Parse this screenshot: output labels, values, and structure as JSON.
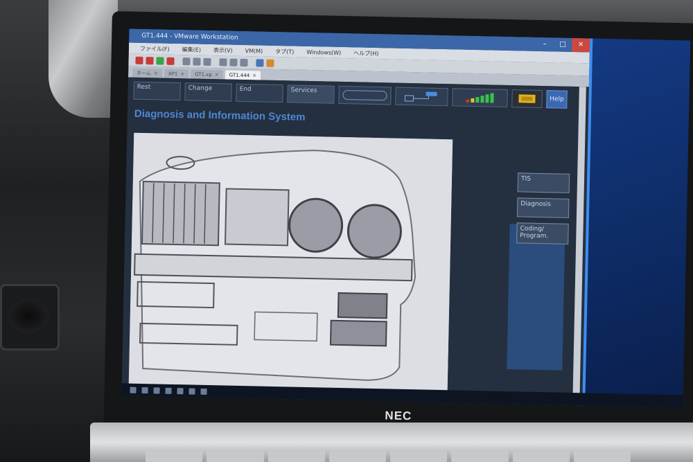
{
  "window": {
    "title": "GT1.444 - VMware Workstation"
  },
  "menu": [
    "ファイル(F)",
    "編集(E)",
    "表示(V)",
    "VM(M)",
    "タブ(T)",
    "Windows(W)",
    "ヘルプ(H)"
  ],
  "tabs": [
    {
      "label": "ホーム",
      "active": false
    },
    {
      "label": "XP1",
      "active": false
    },
    {
      "label": "GT1.xp",
      "active": false
    },
    {
      "label": "GT1.444",
      "active": true
    }
  ],
  "dis": {
    "nav": [
      "Rest",
      "Change",
      "End",
      "Services"
    ],
    "help": "Help",
    "title": "Diagnosis and Information System",
    "side_buttons": [
      "TIS",
      "Diagnosis",
      "Coding/ Program."
    ],
    "signal_colors": [
      "#c83a2a",
      "#d5c52e",
      "#39c24a",
      "#39c24a",
      "#39c24a",
      "#39c24a"
    ]
  },
  "laptop": {
    "brand": "NEC"
  }
}
